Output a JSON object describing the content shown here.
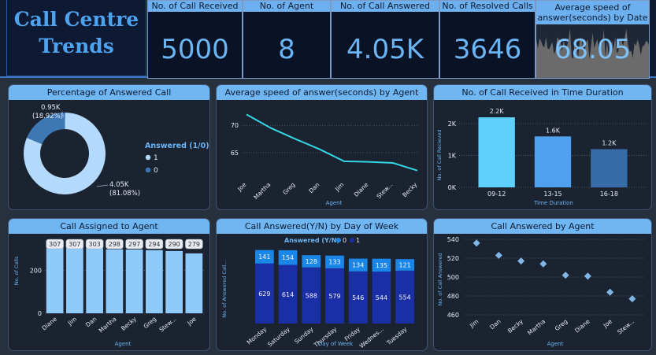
{
  "title": {
    "line1": "Call Centre",
    "line2": "Trends"
  },
  "kpis": [
    {
      "label": "No. of Call Received",
      "value": "5000"
    },
    {
      "label": "No. of Agent",
      "value": "8"
    },
    {
      "label": "No. of Call Answered",
      "value": "4.05K"
    },
    {
      "label": "No. of Resolved Calls",
      "value": "3646"
    },
    {
      "label": "Average speed of answer(seconds) by Date",
      "value": "68.05"
    }
  ],
  "colors": {
    "accent": "#70b6f2",
    "line": "#35d6e4",
    "bar_light": "#8ecbfa",
    "bar_dark": "#1a2fa6",
    "point": "#7fb6e6"
  },
  "chart_data": [
    {
      "id": "answered_pct",
      "type": "pie",
      "title": "Percentage of Answered Call",
      "legend_title": "Answered (1/0)",
      "slices": [
        {
          "name": "1",
          "value": 4054,
          "label": "4.05K",
          "pct_label": "(81.08%)",
          "color": "#b3dafc"
        },
        {
          "name": "0",
          "value": 946,
          "label": "0.95K",
          "pct_label": "(18.92%)",
          "color": "#3d78b5"
        }
      ]
    },
    {
      "id": "speed_by_agent",
      "type": "line",
      "title": "Average speed of answer(seconds) by Agent",
      "xlabel": "Agent",
      "categories": [
        "Joe",
        "Martha",
        "Greg",
        "Dan",
        "Jim",
        "Diane",
        "Stew...",
        "Becky"
      ],
      "values": [
        72.0,
        69.5,
        67.5,
        65.6,
        63.4,
        63.3,
        63.1,
        61.7
      ],
      "yticks": [
        65,
        70
      ],
      "ylim": [
        60.5,
        73.5
      ]
    },
    {
      "id": "received_time",
      "type": "bar",
      "title": "No. of Call Received in Time Duration",
      "xlabel": "Time Duration",
      "ylabel": "No. of Call Recieved",
      "categories": [
        "09-12",
        "13-15",
        "16-18"
      ],
      "values": [
        2200,
        1600,
        1200
      ],
      "value_labels": [
        "2.2K",
        "1.6K",
        "1.2K"
      ],
      "colors": [
        "#5fd0fb",
        "#4fa0ef",
        "#366ca8"
      ],
      "yticks": [
        {
          "v": 0,
          "label": "0K"
        },
        {
          "v": 1000,
          "label": "1K"
        },
        {
          "v": 2000,
          "label": "2K"
        }
      ],
      "ylim": [
        0,
        2250
      ]
    },
    {
      "id": "assigned_agent",
      "type": "bar",
      "title": "Call Assigned to Agent",
      "xlabel": "Agent",
      "ylabel": "No. of Calls",
      "categories": [
        "Diane",
        "Jim",
        "Dan",
        "Martha",
        "Becky",
        "Greg",
        "Stew...",
        "Joe"
      ],
      "values": [
        307,
        307,
        303,
        298,
        297,
        294,
        290,
        279
      ],
      "yticks": [
        0,
        200
      ],
      "ylim": [
        0,
        330
      ]
    },
    {
      "id": "answered_by_day",
      "type": "bar",
      "title": "Call Answered(Y/N) by Day of Week",
      "xlabel": "Day of Week",
      "ylabel": "No. of Answered Call...",
      "legend_title": "Answered (Y/N)",
      "categories": [
        "Monday",
        "Saturday",
        "Sunday",
        "Thursday",
        "Friday",
        "Wednes...",
        "Tuesday"
      ],
      "series": [
        {
          "name": "1",
          "values": [
            629,
            614,
            588,
            579,
            546,
            544,
            554
          ],
          "color": "#1a2fa6"
        },
        {
          "name": "0",
          "values": [
            141,
            154,
            128,
            133,
            134,
            135,
            121
          ],
          "color": "#1a86e8"
        }
      ],
      "ylim": [
        0,
        800
      ]
    },
    {
      "id": "answered_by_agent",
      "type": "scatter",
      "title": "Call Answered by Agent",
      "xlabel": "Agent",
      "ylabel": "No. of Call Answered",
      "categories": [
        "Jim",
        "Dan",
        "Becky",
        "Martha",
        "Greg",
        "Diane",
        "Joe",
        "Stew..."
      ],
      "values": [
        536,
        523,
        517,
        514,
        502,
        501,
        484,
        477
      ],
      "yticks": [
        460,
        480,
        500,
        520,
        540
      ],
      "ylim": [
        460,
        540
      ]
    }
  ]
}
